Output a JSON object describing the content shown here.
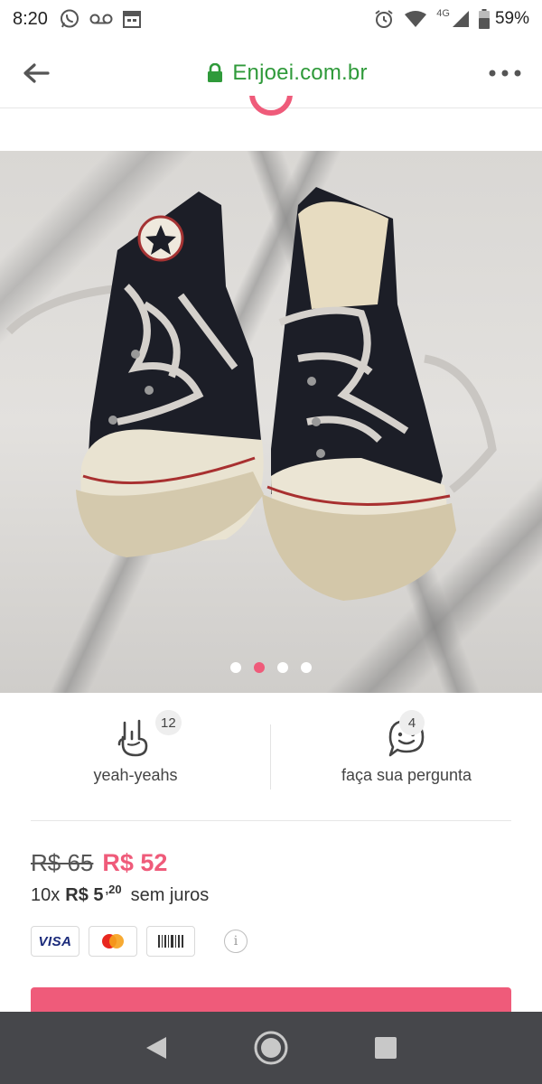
{
  "status_bar": {
    "time": "8:20",
    "network": "4G",
    "battery": "59%"
  },
  "toolbar": {
    "url": "Enjoei.com.br"
  },
  "product": {
    "image_alt": "Tênis Converse All Star cano alto preto, usado",
    "carousel": {
      "total": 4,
      "active_index": 1
    }
  },
  "actions": {
    "yeah": {
      "count": "12",
      "label": "yeah-yeahs"
    },
    "question": {
      "count": "4",
      "label": "faça sua pergunta"
    }
  },
  "price": {
    "old": "R$ 65",
    "new": "R$ 52",
    "installments_count": "10x",
    "installment_value": "R$ 5",
    "installment_cents": ",20",
    "installment_suffix": "sem juros"
  },
  "payments": {
    "visa_label": "VISA",
    "info_symbol": "i"
  },
  "colors": {
    "brand_pink": "#ef5b7a",
    "secure_green": "#2f9a3a",
    "nav_bar": "#46474b"
  }
}
